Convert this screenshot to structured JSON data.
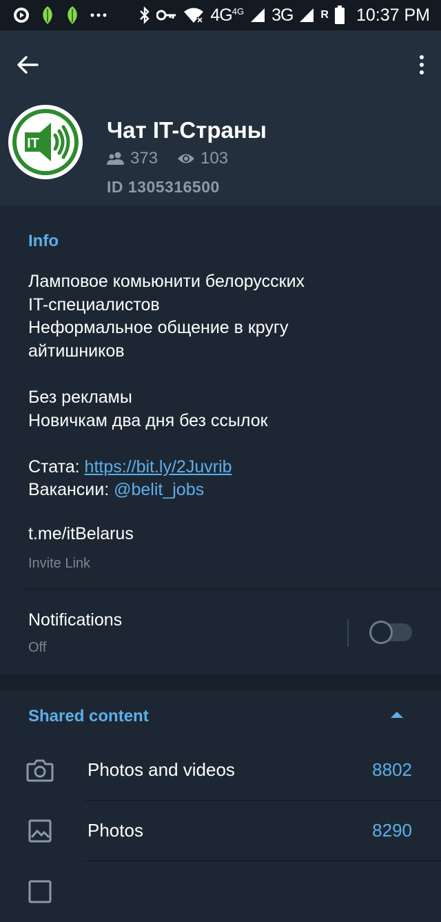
{
  "status_bar": {
    "network_1": "4G",
    "network_1_sup": "4G",
    "network_2": "3G",
    "roaming": "R",
    "time": "10:37 PM"
  },
  "chat": {
    "title": "Чат IT-Страны",
    "avatar_text": "IT",
    "members": "373",
    "online": "103",
    "id_text": "ID 1305316500"
  },
  "info": {
    "section_title": "Info",
    "about_lines": [
      "Ламповое комьюнити белорусских",
      "IT-специалистов",
      "Неформальное общение в кругу",
      "айтишников",
      "",
      "Без рекламы",
      "Новичкам два дня без ссылок",
      ""
    ],
    "stats_prefix": "Стата: ",
    "stats_link": "https://bit.ly/2Juvrib",
    "jobs_prefix": "Вакансии: ",
    "jobs_mention": "@belit_jobs",
    "invite_link": "t.me/itBelarus",
    "invite_label": "Invite Link",
    "notifications_title": "Notifications",
    "notifications_state": "Off"
  },
  "shared": {
    "section_title": "Shared content",
    "items": [
      {
        "label": "Photos and videos",
        "count": "8802",
        "icon": "camera-icon"
      },
      {
        "label": "Photos",
        "count": "8290",
        "icon": "image-icon"
      }
    ]
  },
  "colors": {
    "accent": "#5cafeb",
    "background": "#1d2733",
    "header": "#232f3d",
    "secondary_text": "#8e99a6",
    "avatar_green": "#2e8b2e"
  }
}
